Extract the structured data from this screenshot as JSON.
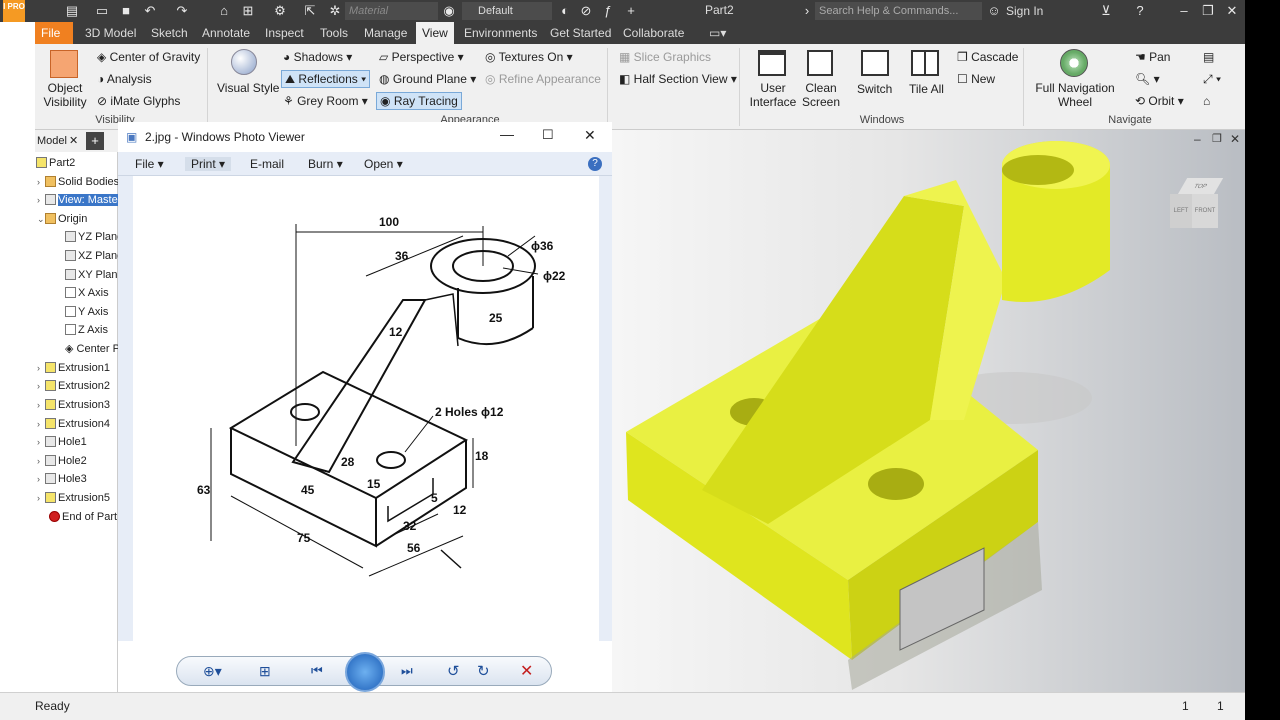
{
  "app": {
    "doc_title": "Part2",
    "logo_text": "I PRO",
    "material_placeholder": "Material",
    "appearance_value": "Default",
    "search_placeholder": "Search Help & Commands...",
    "sign_in": "Sign In"
  },
  "tabs": [
    "File",
    "3D Model",
    "Sketch",
    "Annotate",
    "Inspect",
    "Tools",
    "Manage",
    "View",
    "Environments",
    "Get Started",
    "Collaborate"
  ],
  "active_tab": "View",
  "ribbon": {
    "visibility": {
      "object_visibility": "Object Visibility",
      "center_of_gravity": "Center of Gravity",
      "analysis": "Analysis",
      "imate_glyphs": "iMate Glyphs",
      "group": "Visibility"
    },
    "appearance": {
      "visual_style": "Visual Style",
      "shadows": "Shadows",
      "reflections": "Reflections",
      "grey_room": "Grey Room",
      "perspective": "Perspective",
      "ground_plane": "Ground Plane",
      "ray_tracing": "Ray Tracing",
      "textures_on": "Textures On",
      "refine_appearance": "Refine Appearance",
      "group": "Appearance"
    },
    "slice": {
      "slice_graphics": "Slice Graphics",
      "half_section": "Half Section View"
    },
    "windows": {
      "user_interface": "User Interface",
      "clean_screen": "Clean Screen",
      "switch": "Switch",
      "tile_all": "Tile All",
      "cascade": "Cascade",
      "new": "New",
      "group": "Windows"
    },
    "navigate": {
      "full_nav_wheel": "Full Navigation Wheel",
      "pan": "Pan",
      "orbit": "Orbit",
      "group": "Navigate"
    }
  },
  "browser": {
    "tab_label": "Model",
    "part": "Part2",
    "nodes": [
      "Solid Bodies",
      "View: Master",
      "Origin",
      "YZ Plane",
      "XZ Plane",
      "XY Plane",
      "X Axis",
      "Y Axis",
      "Z Axis",
      "Center Point",
      "Extrusion1",
      "Extrusion2",
      "Extrusion3",
      "Extrusion4",
      "Hole1",
      "Hole2",
      "Hole3",
      "Extrusion5",
      "End of Part"
    ]
  },
  "photo_viewer": {
    "title": "2.jpg - Windows Photo Viewer",
    "menu": [
      "File",
      "Print",
      "E-mail",
      "Burn",
      "Open"
    ],
    "drawing_labels": {
      "d100": "100",
      "d36": "36",
      "dia36": "ϕ36",
      "dia22": "ϕ22",
      "d25": "25",
      "d12a": "12",
      "holes": "2 Holes ϕ12",
      "d28": "28",
      "d15": "15",
      "d45": "45",
      "d18": "18",
      "d63": "63",
      "d75": "75",
      "d32": "32",
      "d56": "56",
      "d12b": "12",
      "d5": "5"
    }
  },
  "viewcube": {
    "top": "TOP",
    "left": "LEFT",
    "front": "FRONT"
  },
  "status": {
    "ready": "Ready",
    "count1": "1",
    "count2": "1"
  },
  "colors": {
    "accent": "#f08020",
    "model_yellow": "#e6ec1c",
    "titlebar": "#3c3c3c"
  }
}
